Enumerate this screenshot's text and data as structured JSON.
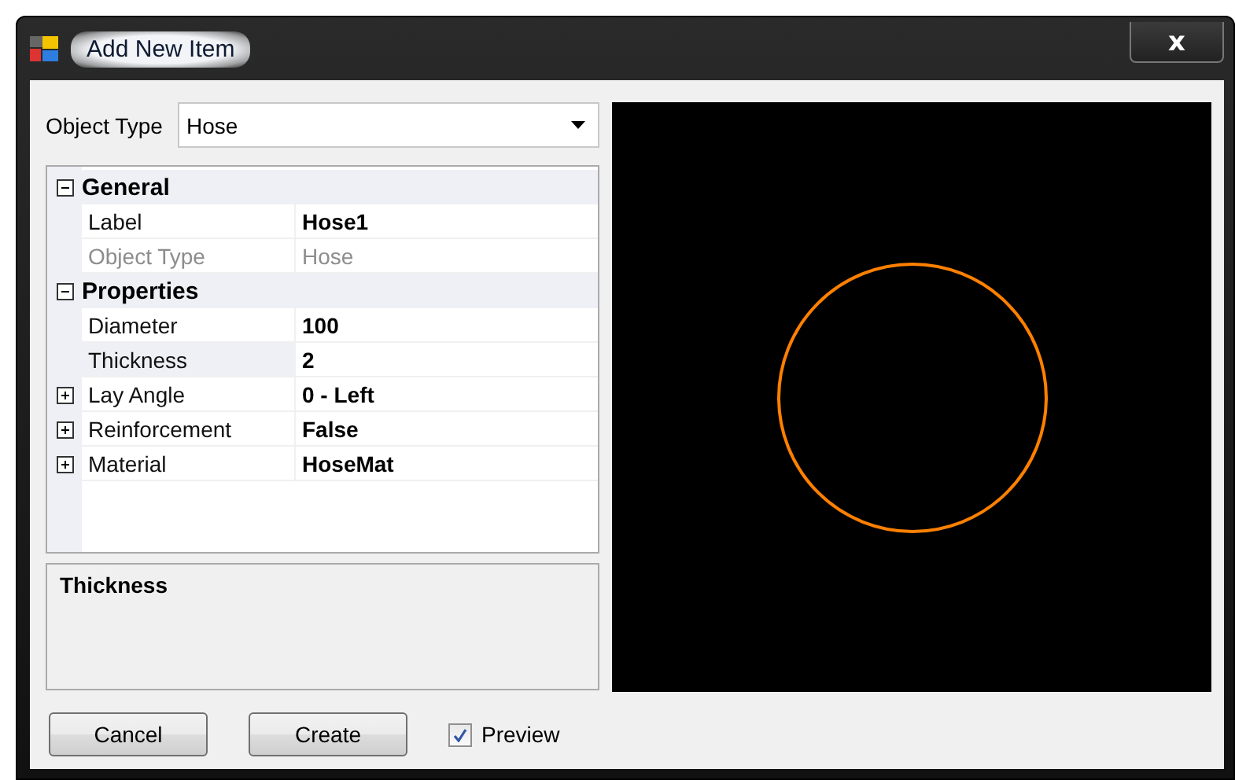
{
  "window": {
    "title": "Add New Item",
    "close": "x"
  },
  "object_type": {
    "label": "Object Type",
    "value": "Hose"
  },
  "property_grid": {
    "categories": [
      {
        "name": "General",
        "expanded": true,
        "items": [
          {
            "label": "Label",
            "value": "Hose1",
            "disabled": false,
            "expandable": false,
            "selected": false
          },
          {
            "label": "Object Type",
            "value": "Hose",
            "disabled": true,
            "expandable": false,
            "selected": false
          }
        ]
      },
      {
        "name": "Properties",
        "expanded": true,
        "items": [
          {
            "label": "Diameter",
            "value": "100",
            "disabled": false,
            "expandable": false,
            "selected": false
          },
          {
            "label": "Thickness",
            "value": "2",
            "disabled": false,
            "expandable": false,
            "selected": true
          },
          {
            "label": "Lay Angle",
            "value": "0 - Left",
            "disabled": false,
            "expandable": true,
            "selected": false
          },
          {
            "label": "Reinforcement",
            "value": "False",
            "disabled": false,
            "expandable": true,
            "selected": false
          },
          {
            "label": "Material",
            "value": "HoseMat",
            "disabled": false,
            "expandable": true,
            "selected": false
          }
        ]
      }
    ]
  },
  "description": {
    "title": "Thickness"
  },
  "buttons": [
    "Cancel",
    "Create"
  ],
  "preview": {
    "label": "Preview",
    "checked": true
  }
}
